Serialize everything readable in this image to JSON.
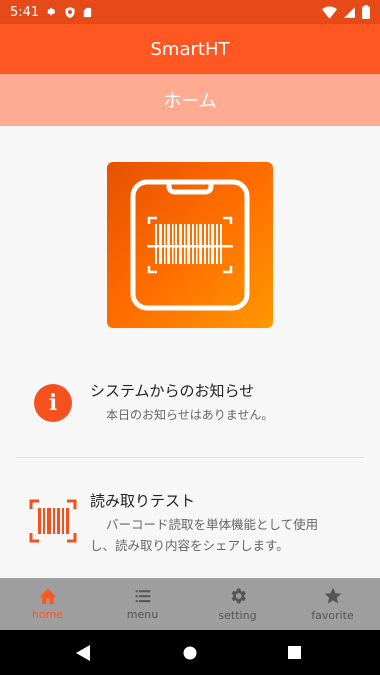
{
  "status_bar": {
    "time": "5:41"
  },
  "app_bar": {
    "title": "SmartHT"
  },
  "sub_bar": {
    "title": "ホーム"
  },
  "notice": {
    "title": "システムからのお知らせ",
    "subtitle": "本日のお知らせはありません。"
  },
  "read_test": {
    "title": "読み取りテスト",
    "line1": "バーコード読取を単体機能として使用",
    "line2": "し、読み取り内容をシェアします。"
  },
  "bottom_nav": {
    "items": [
      {
        "label": "home",
        "icon": "home-icon",
        "active": true
      },
      {
        "label": "menu",
        "icon": "menu-icon",
        "active": false
      },
      {
        "label": "setting",
        "icon": "gear-icon",
        "active": false
      },
      {
        "label": "favorite",
        "icon": "star-icon",
        "active": false
      }
    ]
  },
  "colors": {
    "status_bar": "#e64a19",
    "app_bar": "#ff5722",
    "sub_bar": "#ffab91",
    "accent": "#ff5722",
    "nav_bar": "#9e9e9e"
  }
}
